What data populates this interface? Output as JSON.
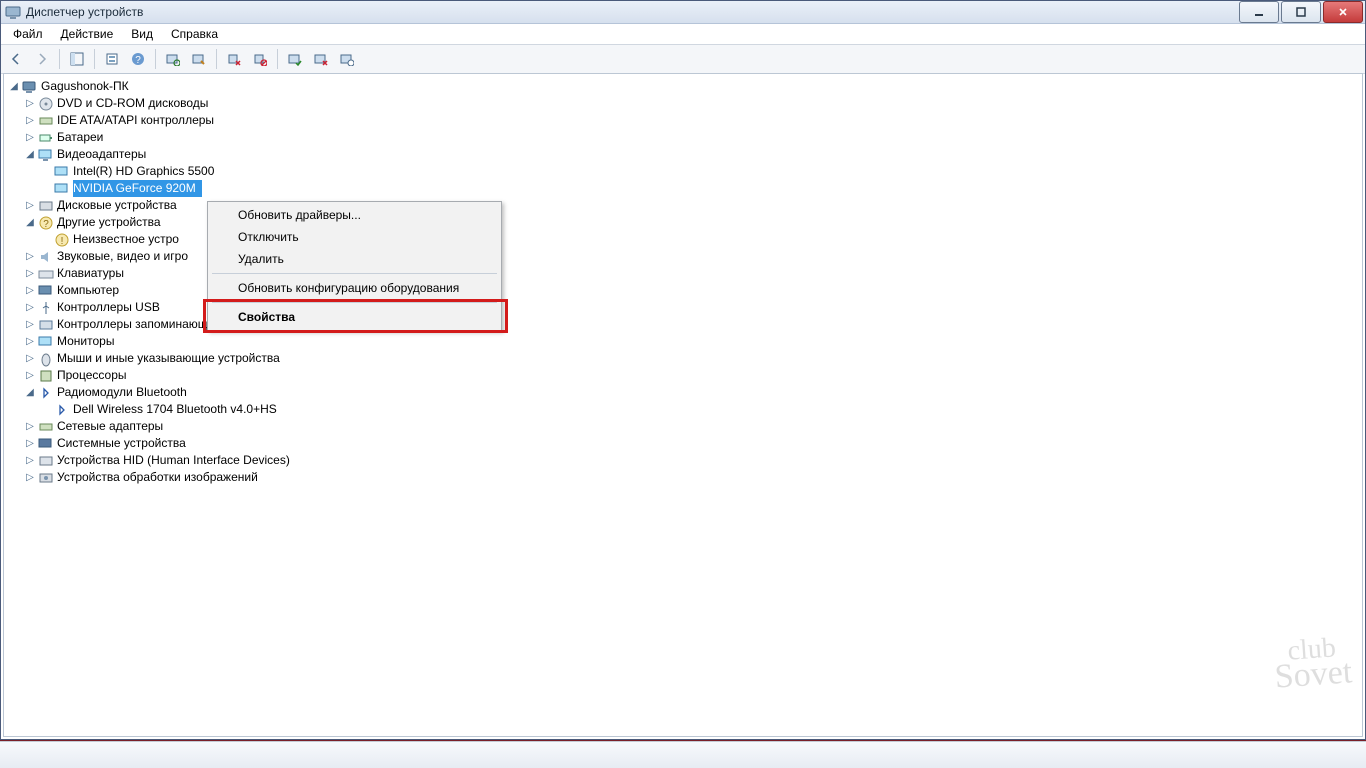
{
  "window": {
    "title": "Диспетчер устройств"
  },
  "menu": {
    "file": "Файл",
    "action": "Действие",
    "view": "Вид",
    "help": "Справка"
  },
  "tree": {
    "root": "Gagushonok-ПК",
    "dvd": "DVD и CD-ROM дисководы",
    "ide": "IDE ATA/ATAPI контроллеры",
    "battery": "Батареи",
    "video": "Видеоадаптеры",
    "video_intel": "Intel(R) HD Graphics 5500",
    "video_nvidia": "NVIDIA GeForce 920M",
    "disk": "Дисковые устройства",
    "other": "Другие устройства",
    "other_unknown": "Неизвестное устро",
    "sound": "Звуковые, видео и игро",
    "keyboard": "Клавиатуры",
    "computer": "Компьютер",
    "usb": "Контроллеры USB",
    "storage": "Контроллеры запоминающих устройств",
    "monitors": "Мониторы",
    "mouse": "Мыши и иные указывающие устройства",
    "cpu": "Процессоры",
    "bt": "Радиомодули Bluetooth",
    "bt_dell": "Dell Wireless 1704 Bluetooth v4.0+HS",
    "net": "Сетевые адаптеры",
    "sys": "Системные устройства",
    "hid": "Устройства HID (Human Interface Devices)",
    "imaging": "Устройства обработки изображений"
  },
  "contextmenu": {
    "update_drivers": "Обновить драйверы...",
    "disable": "Отключить",
    "delete": "Удалить",
    "rescan": "Обновить конфигурацию оборудования",
    "properties": "Свойства"
  },
  "watermark": {
    "line1": "club",
    "line2": "Sovet"
  }
}
